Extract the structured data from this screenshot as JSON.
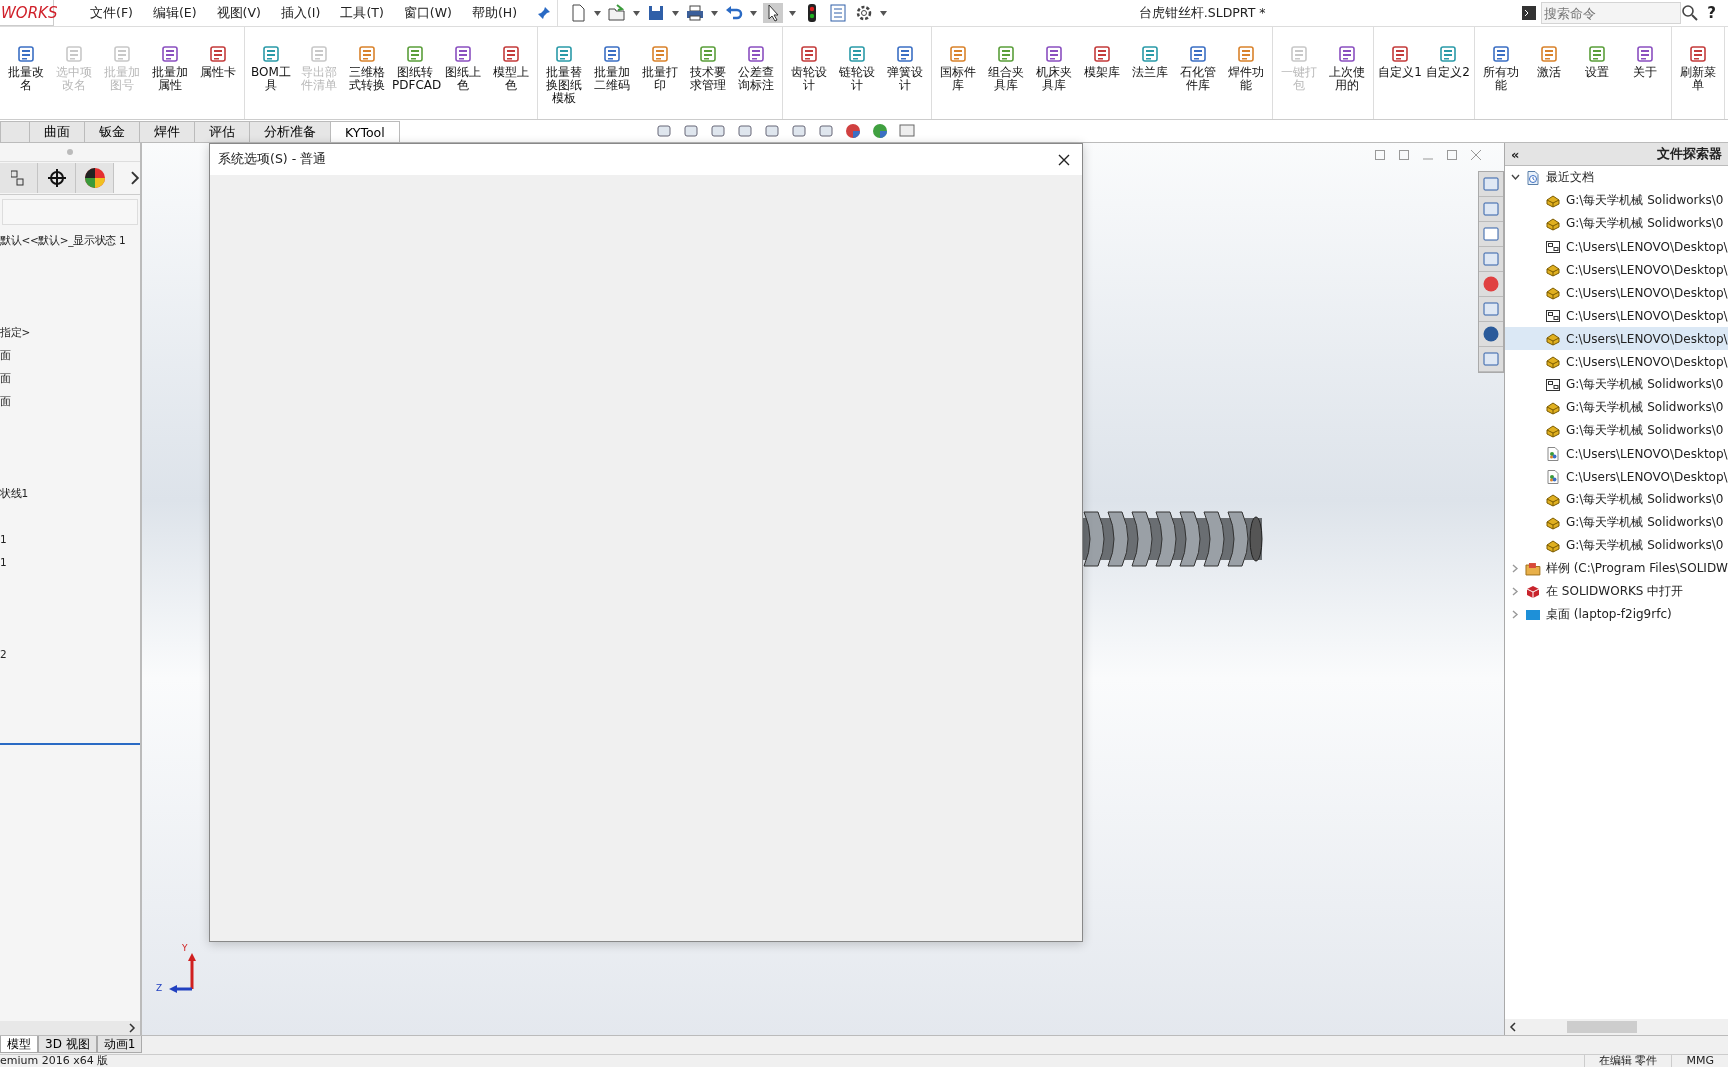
{
  "app": {
    "logo": "WORKS",
    "menus": [
      "文件(F)",
      "编辑(E)",
      "视图(V)",
      "插入(I)",
      "工具(T)",
      "窗口(W)",
      "帮助(H)"
    ],
    "title": "台虎钳丝杆.SLDPRT *",
    "search": {
      "placeholder": "搜索命令"
    },
    "help": "?"
  },
  "ribbon": {
    "groups": [
      {
        "items": [
          {
            "label": "批量改名",
            "disabled": false
          },
          {
            "label": "选中项改名",
            "disabled": true
          },
          {
            "label": "批量加图号",
            "disabled": true
          },
          {
            "label": "批量加属性",
            "disabled": false
          },
          {
            "label": "属性卡",
            "disabled": false
          }
        ]
      },
      {
        "items": [
          {
            "label": "BOM工具",
            "disabled": false
          },
          {
            "label": "导出部件清单",
            "disabled": true
          },
          {
            "label": "三维格式转换",
            "disabled": false
          },
          {
            "label": "图纸转PDFCAD",
            "disabled": false
          },
          {
            "label": "图纸上色",
            "disabled": false
          },
          {
            "label": "模型上色",
            "disabled": false
          }
        ]
      },
      {
        "items": [
          {
            "label": "批量替换图纸模板",
            "disabled": false
          },
          {
            "label": "批量加二维码",
            "disabled": false
          },
          {
            "label": "批量打印",
            "disabled": false
          },
          {
            "label": "技术要求管理",
            "disabled": false
          },
          {
            "label": "公差查询标注",
            "disabled": false
          }
        ]
      },
      {
        "items": [
          {
            "label": "齿轮设计",
            "disabled": false
          },
          {
            "label": "链轮设计",
            "disabled": false
          },
          {
            "label": "弹簧设计",
            "disabled": false
          }
        ]
      },
      {
        "items": [
          {
            "label": "国标件库",
            "disabled": false
          },
          {
            "label": "组合夹具库",
            "disabled": false
          },
          {
            "label": "机床夹具库",
            "disabled": false
          },
          {
            "label": "模架库",
            "disabled": false
          },
          {
            "label": "法兰库",
            "disabled": false
          },
          {
            "label": "石化管件库",
            "disabled": false
          },
          {
            "label": "焊件功能",
            "disabled": false
          }
        ]
      },
      {
        "items": [
          {
            "label": "一键打包",
            "disabled": true
          },
          {
            "label": "上次使用的",
            "disabled": false
          }
        ]
      },
      {
        "items": [
          {
            "label": "自定义1",
            "disabled": false
          },
          {
            "label": "自定义2",
            "disabled": false
          }
        ]
      },
      {
        "items": [
          {
            "label": "所有功能",
            "disabled": false
          },
          {
            "label": "激活",
            "disabled": false
          },
          {
            "label": "设置",
            "disabled": false
          },
          {
            "label": "关于",
            "disabled": false
          }
        ]
      },
      {
        "items": [
          {
            "label": "刷新菜单",
            "disabled": false
          }
        ]
      }
    ]
  },
  "tabs": [
    {
      "label": "曲面",
      "selected": false
    },
    {
      "label": "钣金",
      "selected": false
    },
    {
      "label": "焊件",
      "selected": false
    },
    {
      "label": "评估",
      "selected": false
    },
    {
      "label": "分析准备",
      "selected": false
    },
    {
      "label": "KYTool",
      "selected": true
    }
  ],
  "feature_tree": {
    "rows": [
      "默认<<默认>_显示状态 1",
      "指定>",
      "面",
      "面",
      "面",
      "状线1",
      "1",
      "1",
      "2"
    ]
  },
  "dialog": {
    "title": "系统选项(S) - 普通"
  },
  "triad": {
    "labels": [
      "Y",
      "Z"
    ]
  },
  "file_explorer": {
    "collapse": "«",
    "title": "文件探索器",
    "tree": [
      {
        "label": "最近文档",
        "kind": "recent",
        "expanded": true,
        "children": [
          {
            "label": "G:\\每天学机械 Solidworks\\0",
            "kind": "part",
            "selected": false
          },
          {
            "label": "G:\\每天学机械 Solidworks\\0",
            "kind": "part",
            "selected": false
          },
          {
            "label": "C:\\Users\\LENOVO\\Desktop\\",
            "kind": "drawing",
            "selected": false
          },
          {
            "label": "C:\\Users\\LENOVO\\Desktop\\",
            "kind": "part",
            "selected": false
          },
          {
            "label": "C:\\Users\\LENOVO\\Desktop\\",
            "kind": "part",
            "selected": false
          },
          {
            "label": "C:\\Users\\LENOVO\\Desktop\\",
            "kind": "drawing",
            "selected": false
          },
          {
            "label": "C:\\Users\\LENOVO\\Desktop\\",
            "kind": "part",
            "selected": true
          },
          {
            "label": "C:\\Users\\LENOVO\\Desktop\\",
            "kind": "part",
            "selected": false
          },
          {
            "label": "G:\\每天学机械 Solidworks\\0",
            "kind": "drawing",
            "selected": false
          },
          {
            "label": "G:\\每天学机械 Solidworks\\0",
            "kind": "part",
            "selected": false
          },
          {
            "label": "G:\\每天学机械 Solidworks\\0",
            "kind": "part",
            "selected": false
          },
          {
            "label": "C:\\Users\\LENOVO\\Desktop\\",
            "kind": "image",
            "selected": false
          },
          {
            "label": "C:\\Users\\LENOVO\\Desktop\\",
            "kind": "image",
            "selected": false
          },
          {
            "label": "G:\\每天学机械 Solidworks\\0",
            "kind": "part",
            "selected": false
          },
          {
            "label": "G:\\每天学机械 Solidworks\\0",
            "kind": "part",
            "selected": false
          },
          {
            "label": "G:\\每天学机械 Solidworks\\0",
            "kind": "part",
            "selected": false
          }
        ]
      },
      {
        "label": "样例 (C:\\Program Files\\SOLIDW",
        "kind": "samples",
        "expanded": false
      },
      {
        "label": "在 SOLIDWORKS 中打开",
        "kind": "solidworks",
        "expanded": false
      },
      {
        "label": "桌面 (laptop-f2ig9rfc)",
        "kind": "desktop",
        "expanded": false
      }
    ]
  },
  "bottom_tabs": [
    {
      "label": "模型",
      "selected": true
    },
    {
      "label": "3D 视图",
      "selected": false
    },
    {
      "label": "动画1",
      "selected": false
    }
  ],
  "status_bar": {
    "left": "emium 2016 x64 版",
    "mode": "在编辑 零件",
    "units": "MMG"
  }
}
